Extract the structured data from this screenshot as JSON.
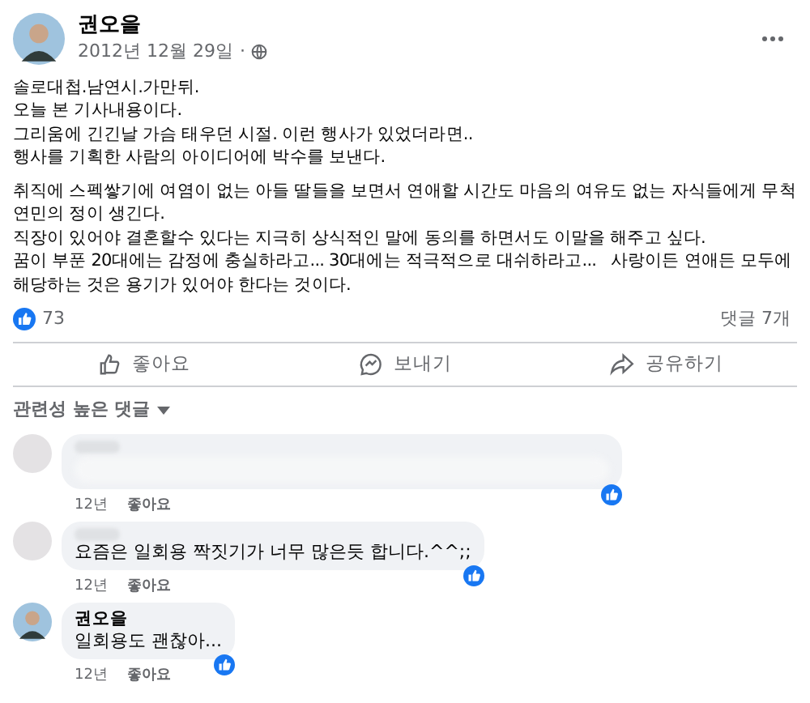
{
  "post": {
    "author": "권오을",
    "date": "2012년 12월 29일",
    "separator": "·",
    "paragraphs": [
      [
        "솔로대첩.남연시.가만뒤.",
        "오늘 본 기사내용이다.",
        "그리움에 긴긴날 가슴 태우던 시절. 이런 행사가 있었더라면..",
        "행사를 기획한 사람의 아이디어에 박수를 보낸다."
      ],
      [
        "취직에 스펙쌓기에 여염이 없는 아들 딸들을 보면서 연애할 시간도 마음의 여유도 없는 자식들에게 무척 연민의 정이 생긴다.",
        "직장이 있어야 결혼할수 있다는 지극히 상식적인 말에 동의를 하면서도 이말을 해주고 싶다.",
        "꿈이 부푼 20대에는 감정에 충실하라고... 30대에는 적극적으로 대쉬하라고...   사랑이든 연애든 모두에 해당하는 것은 용기가 있어야 한다는 것이다."
      ]
    ],
    "reaction_count": "73",
    "comment_count": "댓글 7개"
  },
  "actions": [
    {
      "kind": "like",
      "label": "좋아요"
    },
    {
      "kind": "send",
      "label": "보내기"
    },
    {
      "kind": "share",
      "label": "공유하기"
    }
  ],
  "sort": {
    "label": "관련성 높은 댓글"
  },
  "comments": [
    {
      "avatar_photo": false,
      "name_hidden": true,
      "text_hidden": true,
      "time": "12년",
      "like": "좋아요"
    },
    {
      "avatar_photo": false,
      "name_hidden": true,
      "text_hidden": false,
      "text": "요즘은 일회용 짝짓기가 너무 많은듯 합니다.^^;;",
      "time": "12년",
      "like": "좋아요"
    },
    {
      "avatar_photo": true,
      "name_hidden": false,
      "author": "권오을",
      "text_hidden": false,
      "text": "일회용도 괜찮아...",
      "time": "12년",
      "like": "좋아요"
    }
  ]
}
